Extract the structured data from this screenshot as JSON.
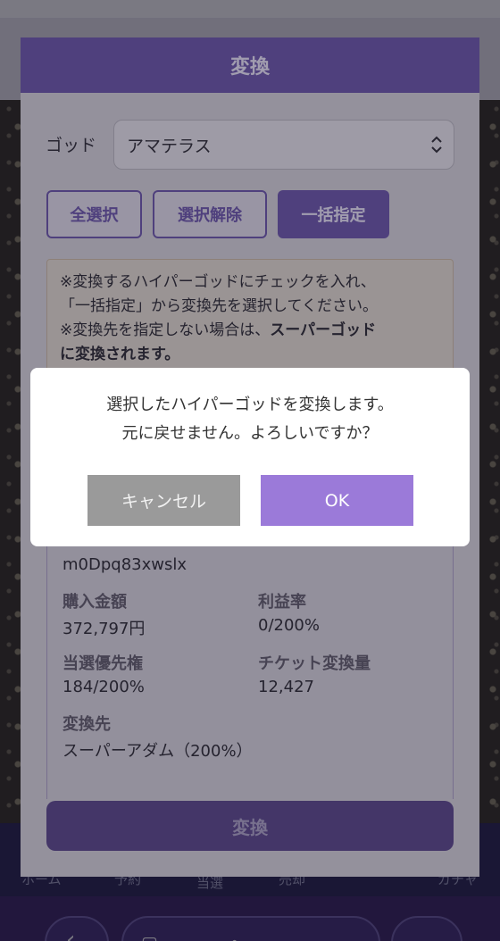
{
  "modal": {
    "title": "変換",
    "god_label": "ゴッド",
    "god_select_value": "アマテラス",
    "buttons": {
      "select_all": "全選択",
      "deselect": "選択解除",
      "bulk_assign": "一括指定"
    },
    "notice": {
      "line1": "※変換するハイパーゴッドにチェックを入れ、",
      "line2": "「一括指定」から変換先を選択してください。",
      "line3_prefix": "※変換先を指定しない場合は、",
      "line3_bold": "スーパーゴッド",
      "line4_bold": "に変換されます。"
    },
    "card": {
      "id": "m0Dpq83xwslx",
      "purchase_label": "購入金額",
      "purchase_value": "372,797円",
      "profit_label": "利益率",
      "profit_value": "0/200%",
      "priority_label": "当選優先権",
      "priority_value": "184/200%",
      "ticket_label": "チケット変換量",
      "ticket_value": "12,427",
      "target_label": "変換先",
      "target_value": "スーパーアダム（200%）"
    },
    "convert_button": "変換"
  },
  "dialog": {
    "message_line1": "選択したハイパーゴッドを変換します。",
    "message_line2": "元に戻せません。よろしいですか？",
    "cancel": "キャンセル",
    "ok": "OK"
  },
  "background_tabs": [
    "ホーム",
    "予約",
    "当選",
    "売却",
    "ガチャ"
  ],
  "colors": {
    "accent": "#6b55a8",
    "ok_button": "#9b7ad9",
    "cancel_button": "#9a9a9a"
  }
}
